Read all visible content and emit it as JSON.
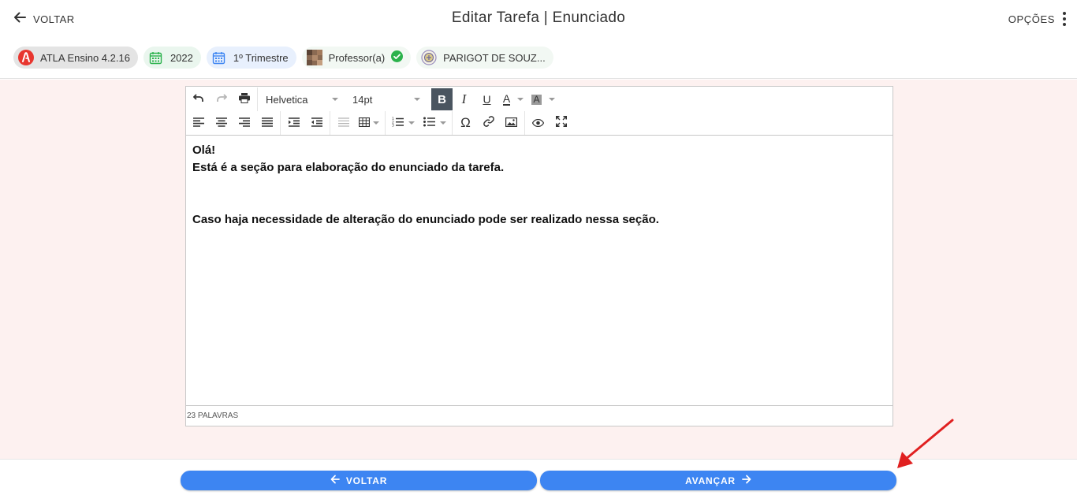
{
  "header": {
    "back_label": "VOLTAR",
    "title": "Editar Tarefa | Enunciado",
    "options_label": "OPÇÕES"
  },
  "chips": [
    {
      "label": "ATLA Ensino 4.2.16",
      "icon": "atla-logo-icon"
    },
    {
      "label": "2022",
      "icon": "calendar-icon"
    },
    {
      "label": "1º Trimestre",
      "icon": "calendar-icon"
    },
    {
      "label": "Professor(a)",
      "icon": "avatar"
    },
    {
      "label": "PARIGOT DE SOUZ...",
      "icon": "school-emblem-icon"
    }
  ],
  "editor": {
    "font_family": "Helvetica",
    "font_size": "14pt",
    "content": [
      "Olá!",
      "Está é a seção para elaboração do enunciado da tarefa.",
      "",
      "",
      "Caso haja necessidade de alteração do enunciado pode ser realizado nessa seção."
    ],
    "word_count": "23 PALAVRAS"
  },
  "footer": {
    "back_label": "VOLTAR",
    "next_label": "AVANÇAR"
  },
  "colors": {
    "primary": "#3d85f2",
    "background_main": "#fdf1f0",
    "annotation_arrow": "#e02020",
    "verified": "#2bb24c"
  }
}
